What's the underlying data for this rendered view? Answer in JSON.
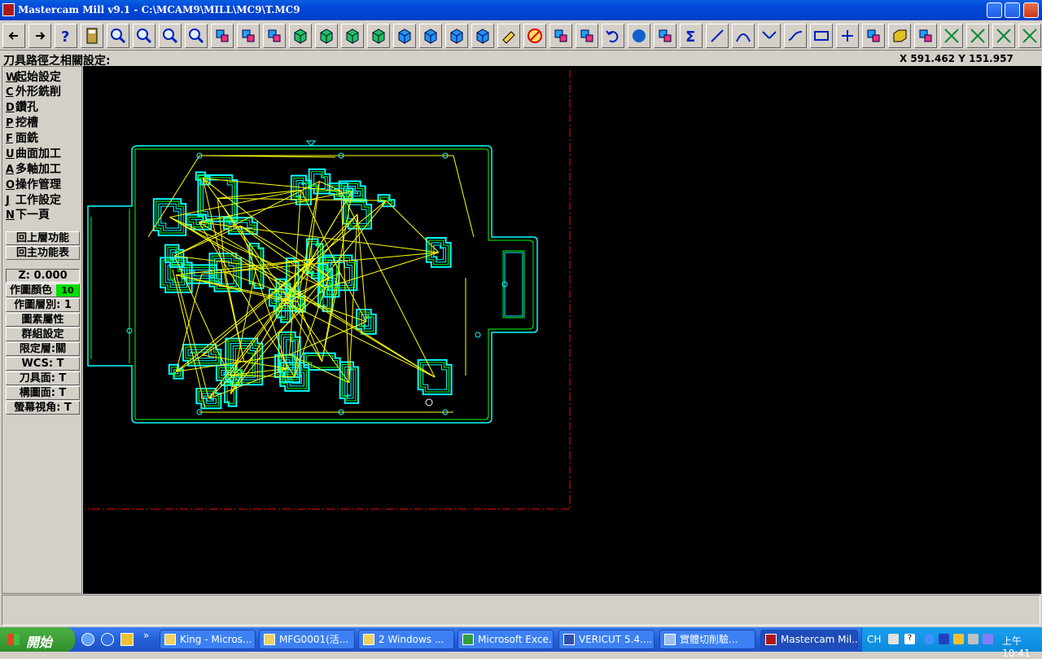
{
  "window": {
    "title": "Mastercam Mill v9.1 - C:\\MCAM9\\MILL\\MC9\\T.MC9"
  },
  "toolbar": {
    "icons": [
      "arrow-left-icon",
      "arrow-right-icon",
      "help-icon",
      "calculator-icon",
      "analyze-icon",
      "zoom-icon",
      "unzoom-icon",
      "zoom-fit-icon",
      "pan-icon",
      "window-select-icon",
      "dynamic-rotate-icon",
      "view-iso-icon",
      "view-top-icon",
      "view-front-icon",
      "view-side-icon",
      "cplane-top-icon",
      "cplane-front-icon",
      "cplane-side-icon",
      "cplane-3d-icon",
      "erase-icon",
      "delete-icon",
      "translate-icon",
      "mirror-icon",
      "undo-icon",
      "shade-icon",
      "transform-icon",
      "sum-icon",
      "line-icon",
      "arc-icon",
      "fillet-icon",
      "spline-icon",
      "rectangle-icon",
      "point-icon",
      "surface-icon",
      "solid-icon",
      "chain-icon",
      "trim-icon",
      "trim-2-icon",
      "break-icon",
      "trim-3-icon"
    ]
  },
  "prompt": "刀具路徑之相關設定:",
  "coords": "X 591.462  Y 151.957",
  "menu": {
    "items": [
      {
        "key": "W",
        "label": "起始設定"
      },
      {
        "key": "C",
        "label": "外形銑削"
      },
      {
        "key": "D",
        "label": "鑽孔"
      },
      {
        "key": "P",
        "label": "挖槽"
      },
      {
        "key": "F",
        "label": "面銑"
      },
      {
        "key": "U",
        "label": "曲面加工"
      },
      {
        "key": "A",
        "label": "多軸加工"
      },
      {
        "key": "O",
        "label": "操作管理"
      },
      {
        "key": "J",
        "label": "工作設定"
      },
      {
        "key": "N",
        "label": "下一頁"
      }
    ],
    "back": "回上層功能",
    "main": "回主功能表",
    "z": "Z:  0.000",
    "color_label": "作圖顏色",
    "color_value": "10",
    "level": "作圖層別: 1",
    "attributes": "圖素屬性",
    "groups": "群組設定",
    "mask": "限定層:關",
    "wcs": "WCS:  T",
    "tplane": "刀具面: T",
    "cplane": "構圖面: T",
    "gview": "螢幕視角: T"
  },
  "colors": {
    "toolpath": "#00ffff",
    "rapid": "#ffff00",
    "geometry": "#00ff00",
    "part": "#00ffff",
    "boundary": "#ff0000",
    "background": "#000000"
  },
  "taskbar": {
    "start": "開始",
    "tasks": [
      "King - Micros...",
      "MFG0001(活...",
      "2 Windows ...",
      "Microsoft Exce...",
      "VERICUT 5.4....",
      "實體切削驗...",
      "Mastercam Mil..."
    ],
    "lang": "CH",
    "clock": "上午 10:41"
  }
}
